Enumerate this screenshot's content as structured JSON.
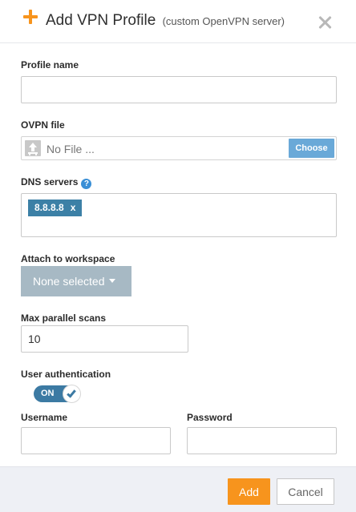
{
  "header": {
    "title": "Add VPN Profile",
    "subtitle": "(custom OpenVPN server)",
    "icons": {
      "add": "plus-icon",
      "close": "close-icon"
    },
    "accent_color": "#f7941d"
  },
  "form": {
    "profile_name": {
      "label": "Profile name",
      "value": ""
    },
    "ovpn_file": {
      "label": "OVPN file",
      "file_text": "No File ...",
      "choose_label": "Choose"
    },
    "dns_servers": {
      "label": "DNS servers",
      "help_icon": "?",
      "tags": [
        {
          "value": "8.8.8.8",
          "remove": "x"
        }
      ]
    },
    "workspace": {
      "label": "Attach to workspace",
      "selected": "None selected"
    },
    "max_parallel_scans": {
      "label": "Max parallel scans",
      "value": "10"
    },
    "user_auth": {
      "label": "User authentication",
      "toggle_text": "ON",
      "enabled": true,
      "toggle_color": "#3c7aa3"
    },
    "username": {
      "label": "Username",
      "value": ""
    },
    "password": {
      "label": "Password",
      "value": ""
    }
  },
  "footer": {
    "add_label": "Add",
    "cancel_label": "Cancel"
  }
}
